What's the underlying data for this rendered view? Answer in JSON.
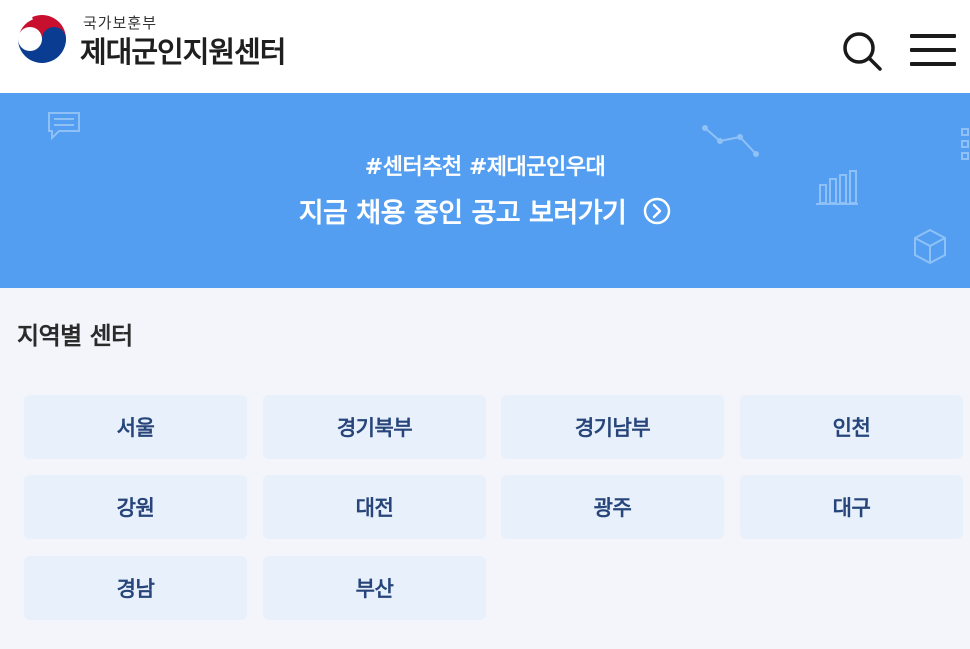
{
  "header": {
    "ministry": "국가보훈부",
    "center_name": "제대군인지원센터",
    "icons": {
      "search": "search-icon",
      "menu": "hamburger-menu-icon",
      "logo": "taegeuk-logo"
    }
  },
  "banner": {
    "tags": "#센터추천 #제대군인우대",
    "cta": "지금 채용 중인 공고 보러가기",
    "icons": [
      "chat-icon",
      "line-graph-icon",
      "bar-chart-icon",
      "cube-icon",
      "grid-icon",
      "chevron-circle-right-icon"
    ]
  },
  "regions": {
    "title": "지역별 센터",
    "items": [
      {
        "label": "서울"
      },
      {
        "label": "경기북부"
      },
      {
        "label": "경기남부"
      },
      {
        "label": "인천"
      },
      {
        "label": "강원"
      },
      {
        "label": "대전"
      },
      {
        "label": "광주"
      },
      {
        "label": "대구"
      },
      {
        "label": "경남"
      },
      {
        "label": "부산"
      }
    ]
  },
  "colors": {
    "banner_bg": "#539ef0",
    "page_bg": "#f3f5fa",
    "region_btn_bg": "#e7f0fb",
    "region_btn_text": "#27457a",
    "logo_red": "#c8102e",
    "logo_blue": "#0a3d91"
  }
}
